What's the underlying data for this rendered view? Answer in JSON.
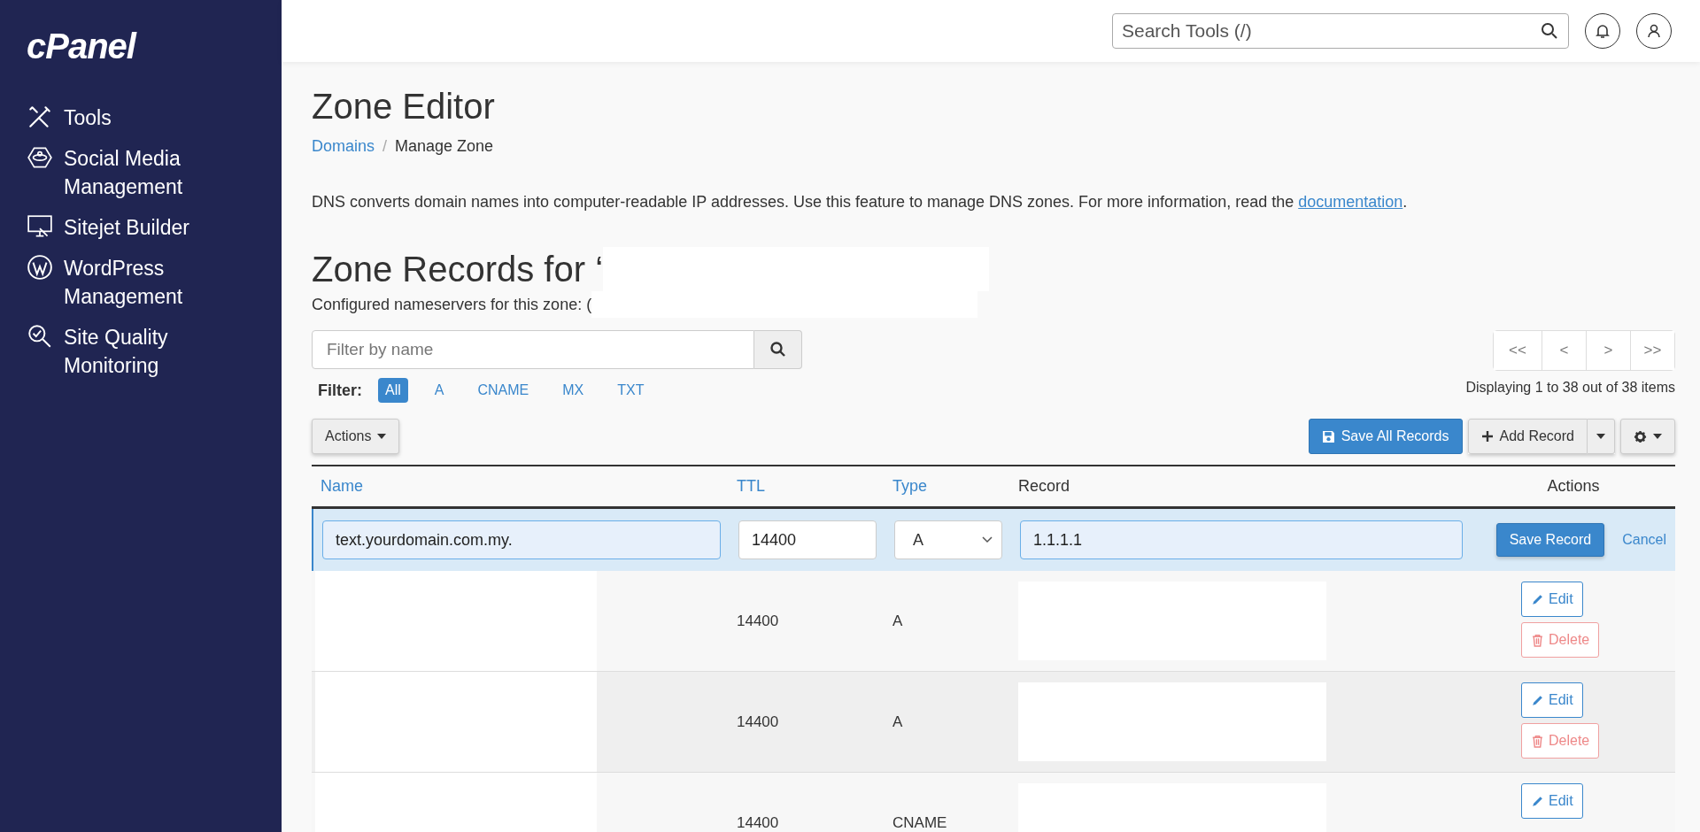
{
  "sidebar": {
    "logo": "cPanel",
    "items": [
      {
        "kind": "tools",
        "label": "Tools"
      },
      {
        "kind": "social",
        "label": "Social Media Management"
      },
      {
        "kind": "sitejet",
        "label": "Sitejet Builder"
      },
      {
        "kind": "wordpress",
        "label": "WordPress Management"
      },
      {
        "kind": "quality",
        "label": "Site Quality Monitoring"
      }
    ]
  },
  "topbar": {
    "search": {
      "placeholder": "Search Tools (/)"
    }
  },
  "page": {
    "title": "Zone Editor",
    "breadcrumb_separator": "/",
    "breadcrumb": [
      {
        "label": "Domains",
        "link": true
      },
      {
        "label": "Manage Zone",
        "link": false
      }
    ],
    "description": "DNS converts domain names into computer-readable IP addresses. Use this feature to manage DNS zones. For more information, read the ",
    "description_link": "documentation",
    "description_end": "."
  },
  "zone": {
    "heading": "Zone Records for ‘",
    "nameservers_label": "Configured nameservers for this zone: ("
  },
  "filter": {
    "placeholder": "Filter by name",
    "label": "Filter:",
    "types": [
      {
        "label": "All",
        "selected": true
      },
      {
        "label": "A",
        "selected": false
      },
      {
        "label": "CNAME",
        "selected": false
      },
      {
        "label": "MX",
        "selected": false
      },
      {
        "label": "TXT",
        "selected": false
      }
    ]
  },
  "pagination": {
    "buttons": [
      "<<",
      "<",
      ">",
      ">>"
    ],
    "summary": "Displaying 1 to 38 out of 38 items"
  },
  "toolbar": {
    "actions": "Actions",
    "save_all": "Save All Records",
    "add_record": "Add Record"
  },
  "table": {
    "columns": [
      {
        "label": "Name",
        "sortable": true
      },
      {
        "label": "TTL",
        "sortable": true
      },
      {
        "label": "Type",
        "sortable": true
      },
      {
        "label": "Record",
        "sortable": false
      },
      {
        "label": "Actions",
        "sortable": false
      }
    ],
    "edit_row": {
      "name": "text.yourdomain.com.my.",
      "ttl": "14400",
      "type": "A",
      "record": "1.1.1.1",
      "save": "Save Record",
      "cancel": "Cancel"
    },
    "rows": [
      {
        "ttl": "14400",
        "type": "A",
        "actions": [
          "Edit",
          "Delete"
        ]
      },
      {
        "ttl": "14400",
        "type": "A",
        "actions": [
          "Edit",
          "Delete"
        ]
      },
      {
        "ttl": "14400",
        "type": "CNAME",
        "actions": [
          "Edit"
        ]
      }
    ]
  }
}
